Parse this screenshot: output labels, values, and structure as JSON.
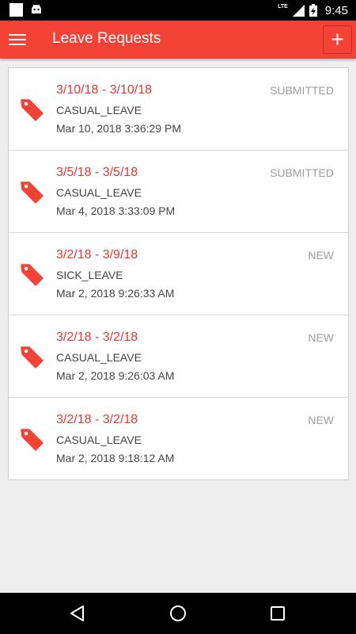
{
  "status_bar": {
    "network": "LTE",
    "time": "9:45",
    "icons": [
      "notification-square-icon",
      "android-icon",
      "signal-icon",
      "battery-charging-icon"
    ]
  },
  "app_bar": {
    "title": "Leave Requests",
    "menu_icon": "hamburger-menu-icon",
    "add_label": "+"
  },
  "requests": [
    {
      "date_range": "3/10/18 - 3/10/18",
      "type": "CASUAL_LEAVE",
      "created": "Mar 10, 2018 3:36:29 PM",
      "status": "SUBMITTED"
    },
    {
      "date_range": "3/5/18 - 3/5/18",
      "type": "CASUAL_LEAVE",
      "created": "Mar 4, 2018 3:33:09 PM",
      "status": "SUBMITTED"
    },
    {
      "date_range": "3/2/18 - 3/9/18",
      "type": "SICK_LEAVE",
      "created": "Mar 2, 2018 9:26:33 AM",
      "status": "NEW"
    },
    {
      "date_range": "3/2/18 - 3/2/18",
      "type": "CASUAL_LEAVE",
      "created": "Mar 2, 2018 9:26:03 AM",
      "status": "NEW"
    },
    {
      "date_range": "3/2/18 - 3/2/18",
      "type": "CASUAL_LEAVE",
      "created": "Mar 2, 2018 9:18:12 AM",
      "status": "NEW"
    }
  ],
  "nav_bar": {
    "icons": [
      "back-icon",
      "home-icon",
      "recents-icon"
    ]
  },
  "colors": {
    "primary": "#f44336",
    "accent_text": "#e53935",
    "status_text": "#9e9e9e",
    "background": "#eeeeee"
  }
}
